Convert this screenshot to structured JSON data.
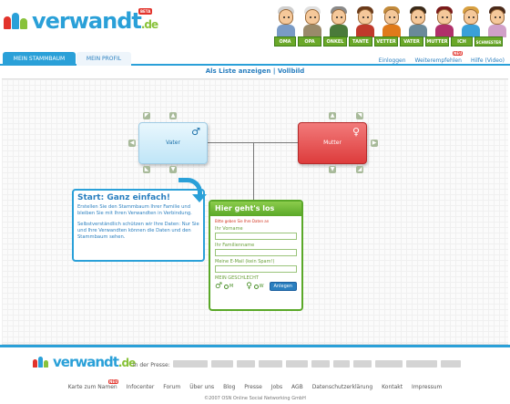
{
  "header": {
    "logo_text": "verwandt",
    "logo_tld": ".de",
    "beta_badge": "BETA",
    "family_tabs": [
      "OMA",
      "OPA",
      "ONKEL",
      "TANTE",
      "VETTER",
      "VATER",
      "MUTTER",
      "ICH",
      "SCHWESTER"
    ]
  },
  "nav": {
    "tab_active": "MEIN STAMMBAUM",
    "tab_inactive": "MEIN PROFIL",
    "links": [
      "Einloggen",
      "Weiterempfehlen",
      "Hilfe (Video)"
    ],
    "neu_badge": "NEU"
  },
  "subbar": {
    "list_view": "Als Liste anzeigen",
    "separator": "|",
    "fullscreen": "Vollbild"
  },
  "tree": {
    "vater_label": "Vater",
    "mutter_label": "Mutter",
    "vater_symbol": "♂",
    "mutter_symbol": "♀"
  },
  "start": {
    "title": "Start: Ganz einfach!",
    "para1": "Erstellen Sie den Stammbaum Ihrer Familie und bleiben Sie mit Ihren Verwandten in Verbindung.",
    "para2": "Selbstverständlich schützen wir Ihre Daten: Nur Sie und Ihre Verwandten können die Daten und den Stammbaum sehen."
  },
  "form": {
    "title": "Hier geht's los",
    "note": "Bitte geben Sie Ihre Daten an",
    "first_name_label": "Ihr Vorname",
    "last_name_label": "Ihr Familienname",
    "email_label": "Meine E-Mail (kein Spam!)",
    "gender_label": "MEIN GESCHLECHT",
    "male_symbol": "♂",
    "male_label": "M",
    "female_symbol": "♀",
    "female_label": "W",
    "submit_label": "Anlegen"
  },
  "footer": {
    "press_label": "in der Presse:",
    "links": [
      "Karte zum Namen",
      "Infocenter",
      "Forum",
      "Über uns",
      "Blog",
      "Presse",
      "Jobs",
      "AGB",
      "Datenschutzerklärung",
      "Kontakt",
      "Impressum"
    ],
    "neu_badge": "NEU",
    "copyright": "©2007 OSN Online Social Networking GmbH"
  },
  "colors": {
    "accent_blue": "#2aa0d8",
    "accent_green": "#5aa828",
    "mutter_red": "#dd3c3c"
  }
}
